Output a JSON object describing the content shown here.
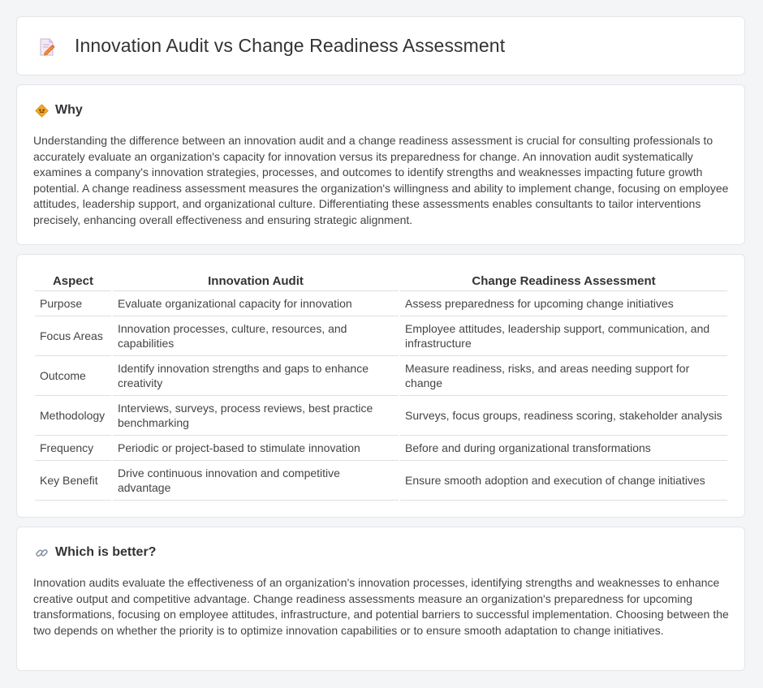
{
  "header": {
    "title": "Innovation Audit vs Change Readiness Assessment",
    "icon": "document-edit-icon"
  },
  "why": {
    "heading": "Why",
    "icon": "diamond-sign-icon",
    "text": "Understanding the difference between an innovation audit and a change readiness assessment is crucial for consulting professionals to accurately evaluate an organization's capacity for innovation versus its preparedness for change. An innovation audit systematically examines a company's innovation strategies, processes, and outcomes to identify strengths and weaknesses impacting future growth potential. A change readiness assessment measures the organization's willingness and ability to implement change, focusing on employee attitudes, leadership support, and organizational culture. Differentiating these assessments enables consultants to tailor interventions precisely, enhancing overall effectiveness and ensuring strategic alignment."
  },
  "table": {
    "headers": [
      "Aspect",
      "Innovation Audit",
      "Change Readiness Assessment"
    ],
    "rows": [
      [
        "Purpose",
        "Evaluate organizational capacity for innovation",
        "Assess preparedness for upcoming change initiatives"
      ],
      [
        "Focus Areas",
        "Innovation processes, culture, resources, and capabilities",
        "Employee attitudes, leadership support, communication, and infrastructure"
      ],
      [
        "Outcome",
        "Identify innovation strengths and gaps to enhance creativity",
        "Measure readiness, risks, and areas needing support for change"
      ],
      [
        "Methodology",
        "Interviews, surveys, process reviews, best practice benchmarking",
        "Surveys, focus groups, readiness scoring, stakeholder analysis"
      ],
      [
        "Frequency",
        "Periodic or project-based to stimulate innovation",
        "Before and during organizational transformations"
      ],
      [
        "Key Benefit",
        "Drive continuous innovation and competitive advantage",
        "Ensure smooth adoption and execution of change initiatives"
      ]
    ]
  },
  "better": {
    "heading": "Which is better?",
    "icon": "link-icon",
    "text": "Innovation audits evaluate the effectiveness of an organization's innovation processes, identifying strengths and weaknesses to enhance creative output and competitive advantage. Change readiness assessments measure an organization's preparedness for upcoming transformations, focusing on employee attitudes, infrastructure, and potential barriers to successful implementation. Choosing between the two depends on whether the priority is to optimize innovation capabilities or to ensure smooth adaptation to change initiatives."
  },
  "colors": {
    "background": "#f4f5f7",
    "card": "#ffffff",
    "border": "#e3e5e8",
    "icon_orange": "#f5a623"
  }
}
